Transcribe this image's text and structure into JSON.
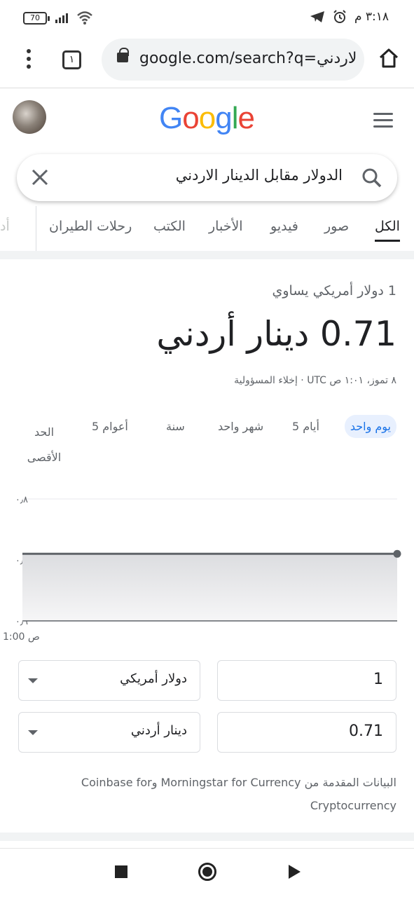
{
  "status_bar": {
    "battery": "70",
    "time": "٣:١٨ م"
  },
  "browser": {
    "url": "google.com/search?q=الاردني",
    "tab_count": "١"
  },
  "search": {
    "query": "الدولار مقابل الدينار الاردني"
  },
  "tabs": [
    "الكل",
    "صور",
    "فيديو",
    "الأخبار",
    "الكتب",
    "رحلات الطيران",
    "أد"
  ],
  "card": {
    "subtitle": "1 دولار أمريكي يساوي",
    "result": "0.71 دينار أردني",
    "date_line": "٨ تموز، ١:٠١ ص UTC · إخلاء المسؤولية"
  },
  "ranges": [
    "يوم واحد",
    "5 أيام",
    "شهر واحد",
    "سنة",
    "5 أعوام",
    "الحد الأقصى"
  ],
  "chart_data": {
    "type": "area",
    "x": [
      "1:00 ص"
    ],
    "series": [
      {
        "values": [
          0.71,
          0.71
        ]
      }
    ],
    "ytick_labels": [
      "٠٫٨",
      "٠٫٧",
      "٠٫٦"
    ],
    "yticks": [
      0.8,
      0.7,
      0.6
    ],
    "ylim": [
      0.6,
      0.8
    ],
    "xtick_labels": [
      "1:00 ص"
    ],
    "grid": true
  },
  "converter": {
    "from_amount": "1",
    "from_currency": "دولار أمريكي",
    "to_amount": "0.71",
    "to_currency": "دينار أردني"
  },
  "source_text": "البيانات المقدمة من Morningstar for Currency وCoinbase for Cryptocurrency",
  "colors": {
    "google_blue": "#4285F4",
    "google_red": "#EA4335",
    "google_yellow": "#FBBC05",
    "google_green": "#34A853",
    "accent": "#1a73e8"
  }
}
